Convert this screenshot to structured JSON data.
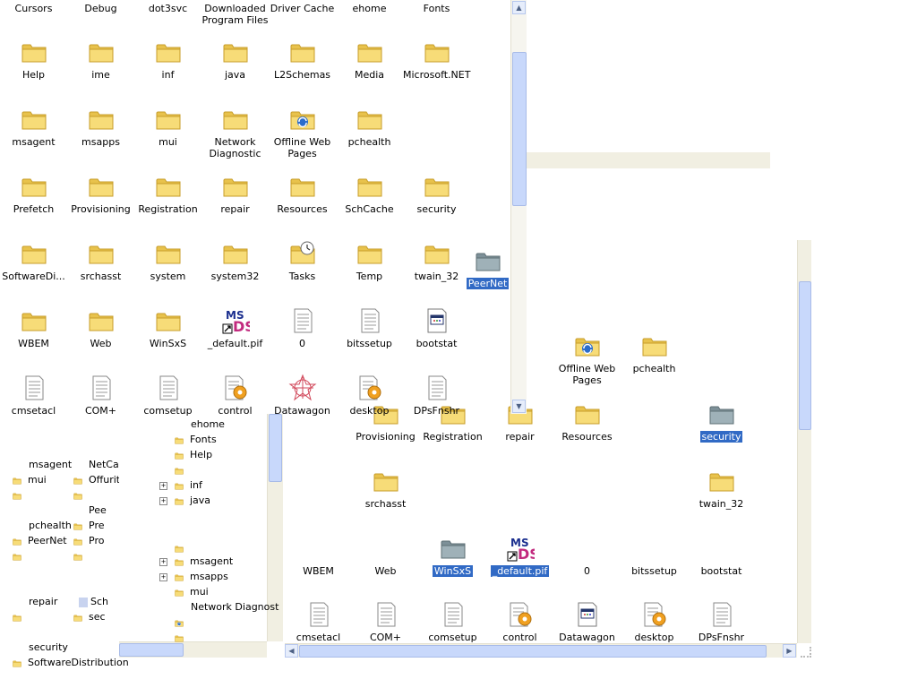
{
  "top_strip": [
    "Cursors",
    "Debug",
    "dot3svc",
    "Downloaded Program Files",
    "Driver Cache",
    "ehome",
    "Fonts"
  ],
  "main_grid": [
    [
      "Help",
      "ime",
      "inf",
      "java",
      "L2Schemas",
      "Media",
      "Microsoft.NET"
    ],
    [
      "msagent",
      "msapps",
      "mui",
      "Network Diagnostic",
      "Offline Web Pages",
      "pchealth"
    ],
    [
      "Prefetch",
      "Provisioning",
      "Registration",
      "repair",
      "Resources",
      "SchCache",
      "security"
    ],
    [
      "SoftwareDi...",
      "srchasst",
      "system",
      "system32",
      "Tasks",
      "Temp",
      "twain_32"
    ],
    [
      "WBEM",
      "Web",
      "WinSxS",
      "_default.pif",
      "0",
      "bitssetup",
      "bootstat"
    ],
    [
      "cmsetacl",
      "COM+",
      "comsetup",
      "control",
      "Datawagon",
      "desktop",
      "DPsFnshr"
    ]
  ],
  "floating_icon": "PeerNet",
  "right_window": {
    "row1": [
      "Offline Web Pages",
      "pchealth"
    ],
    "row2": [
      "Provisioning",
      "Registration",
      "repair",
      "Resources",
      "security"
    ],
    "row3": [
      "srchasst",
      "twain_32"
    ],
    "row4": [
      "WBEM",
      "Web",
      "WinSxS",
      "_default.pif",
      "0",
      "bitssetup",
      "bootstat"
    ],
    "row5": [
      "cmsetacl",
      "COM+",
      "comsetup",
      "control",
      "Datawagon",
      "desktop",
      "DPsFnshr"
    ]
  },
  "tree": {
    "items": [
      "ehome",
      "Fonts",
      "Help",
      "",
      "inf",
      "java",
      "",
      "msagent",
      "msapps",
      "mui",
      "Network Diagnost",
      ""
    ]
  },
  "small_icons": {
    "col1": [
      "msagent",
      "mui",
      "",
      "pchealth",
      "PeerNet",
      "",
      "repair",
      "",
      "security",
      "SoftwareDistribution"
    ],
    "col2": [
      "NetCache",
      "Offurity",
      "",
      "Pee",
      "Pre",
      "Pro",
      "Sch",
      "sec"
    ]
  },
  "colors": {
    "selection": "#316ac5",
    "folder": "#f2d35b",
    "folder_dark": "#d9b33a",
    "scroll": "#c8d8fb"
  }
}
